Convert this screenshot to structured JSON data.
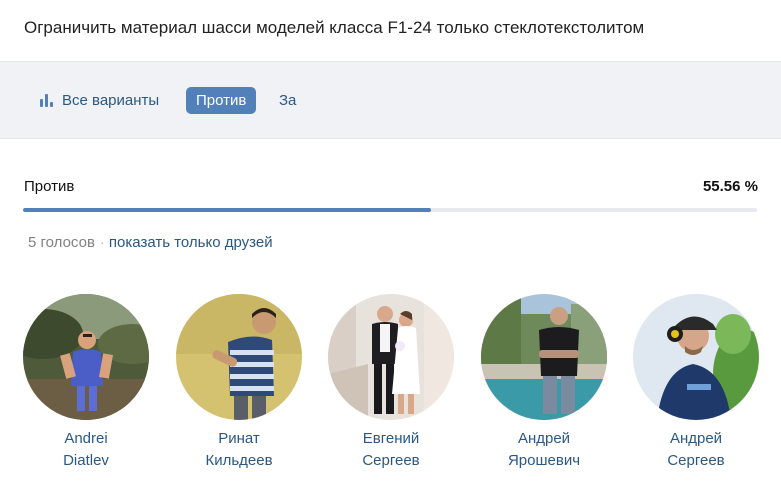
{
  "poll": {
    "question": "Ограничить материал шасси моделей класса F1-24 только стеклотекстолитом"
  },
  "tabs": {
    "all_label": "Все варианты",
    "against_label": "Против",
    "for_label": "За",
    "active": "Против"
  },
  "result": {
    "option_label": "Против",
    "percent_text": "55.56 %",
    "percent_value": 55.56,
    "votes_text": "5 голосов",
    "friends_link": "показать только друзей"
  },
  "voters": [
    {
      "first": "Andrei",
      "last": "Diatlev"
    },
    {
      "first": "Ринат",
      "last": "Кильдеев"
    },
    {
      "first": "Евгений",
      "last": "Сергеев"
    },
    {
      "first": "Андрей",
      "last": "Ярошевич"
    },
    {
      "first": "Андрей",
      "last": "Сергеев"
    }
  ],
  "icons": {
    "all_variants": "bar-chart-icon"
  },
  "colors": {
    "accent": "#5181b8",
    "link": "#2a5885",
    "tabbar_bg": "#f0f2f5",
    "progress_track": "#e6e9ed",
    "muted": "#828282"
  }
}
